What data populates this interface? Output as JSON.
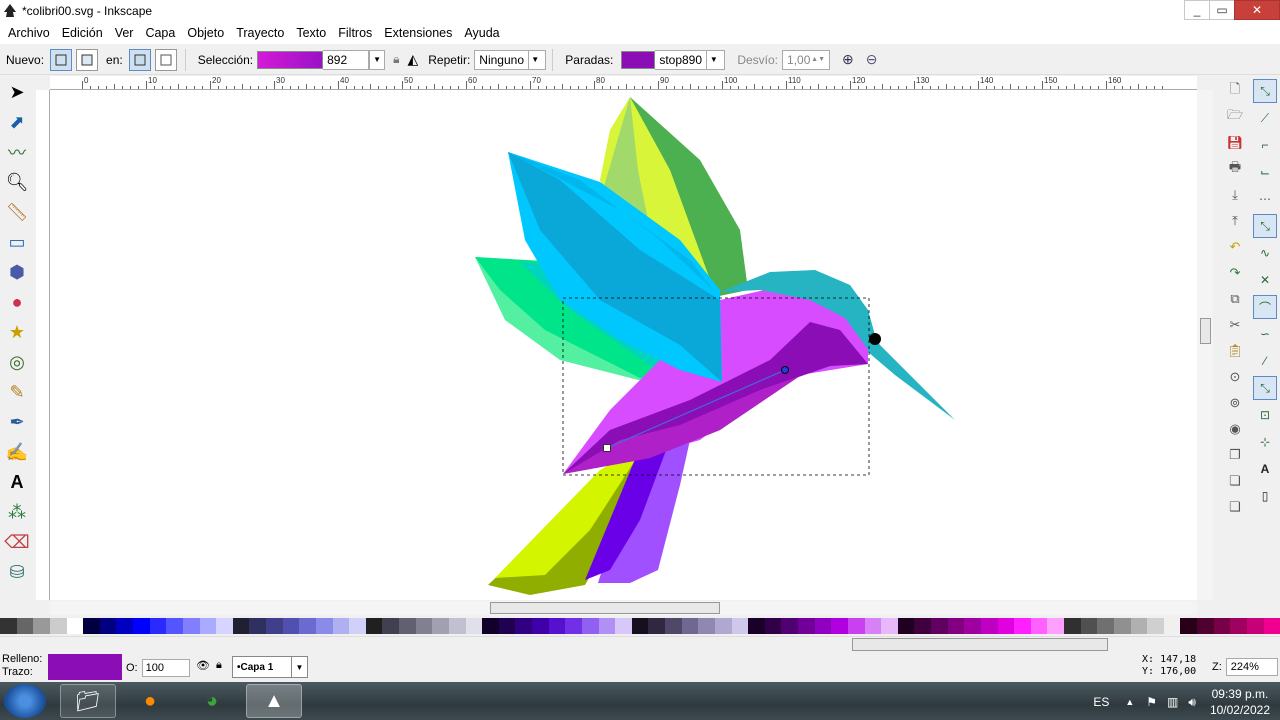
{
  "window": {
    "title": "*colibri00.svg - Inkscape",
    "min": "_",
    "max": "▭",
    "close": "✕"
  },
  "menu": [
    "Archivo",
    "Edición",
    "Ver",
    "Capa",
    "Objeto",
    "Trayecto",
    "Texto",
    "Filtros",
    "Extensiones",
    "Ayuda"
  ],
  "toolctrl": {
    "nuevo_label": "Nuevo:",
    "en_label": "en:",
    "seleccion_label": "Selección:",
    "seleccion_value": "892",
    "repetir_label": "Repetir:",
    "repetir_value": "Ninguno",
    "paradas_label": "Paradas:",
    "paradas_value": "stop890",
    "desvio_label": "Desvío:",
    "desvio_value": "1,00"
  },
  "ruler": {
    "labels": [
      "0",
      "10",
      "20",
      "30",
      "40",
      "50",
      "60",
      "70",
      "80",
      "90",
      "100",
      "110",
      "120",
      "130",
      "140",
      "150",
      "160"
    ]
  },
  "status": {
    "relleno_label": "Relleno:",
    "trazo_label": "Trazo:",
    "fill_color": "#8a0db5",
    "opacity_label": "O:",
    "opacity_value": "100",
    "layer_value": "•Capa 1",
    "x_label": "X:",
    "x_value": "147,18",
    "y_label": "Y:",
    "y_value": "176,00",
    "zoom_label": "Z:",
    "zoom_value": "224%"
  },
  "taskbar": {
    "lang": "ES",
    "time": "09:39 p.m.",
    "date": "10/02/2022"
  },
  "colors": {
    "accent": "#5b8cc5",
    "gradient_start": "#d41ad8",
    "gradient_end": "#9a12c6"
  }
}
